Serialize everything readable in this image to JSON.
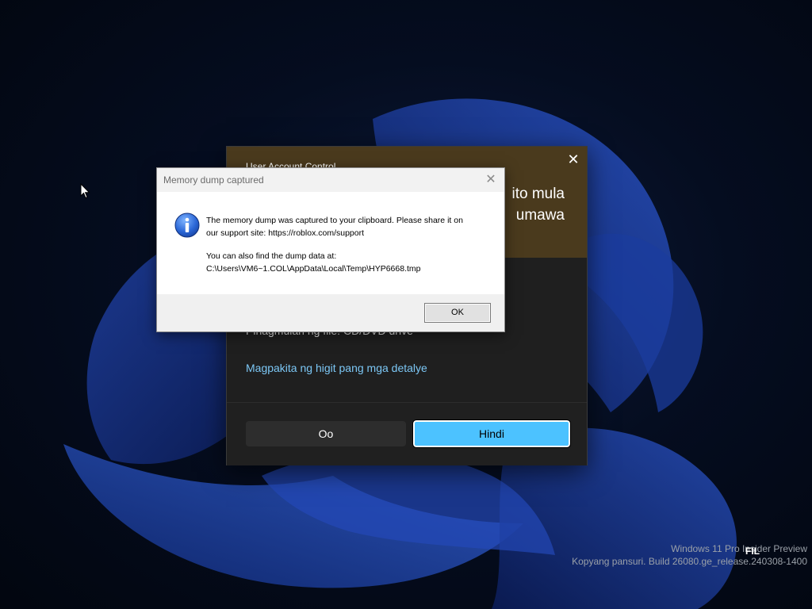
{
  "uac": {
    "title": "User Account Control",
    "heading_line1": "ito mula",
    "heading_line2": "umawa",
    "source_text": "Pinagmulan ng file: CD/DVD drive",
    "details_link": "Magpakita ng higit pang mga detalye",
    "yes_label": "Oo",
    "no_label": "Hindi",
    "close_icon": "close-icon",
    "header_color": "#4a3a1d",
    "accent_color": "#4cc2ff"
  },
  "dump_dialog": {
    "title": "Memory dump captured",
    "line1": "The memory dump was captured to your clipboard. Please share it on",
    "line2": "our support site: https://roblox.com/support",
    "line3": "You can also find the dump data at:",
    "line4": "C:\\Users\\VM6~1.COL\\AppData\\Local\\Temp\\HYP6668.tmp",
    "ok_label": "OK",
    "icon": "info-icon",
    "close_icon": "close-icon"
  },
  "watermark": {
    "line1": "Windows 11 Pro Insider Preview",
    "line2": "Kopyang pansuri. Build 26080.ge_release.240308-1400"
  },
  "language_indicator": "FIL"
}
